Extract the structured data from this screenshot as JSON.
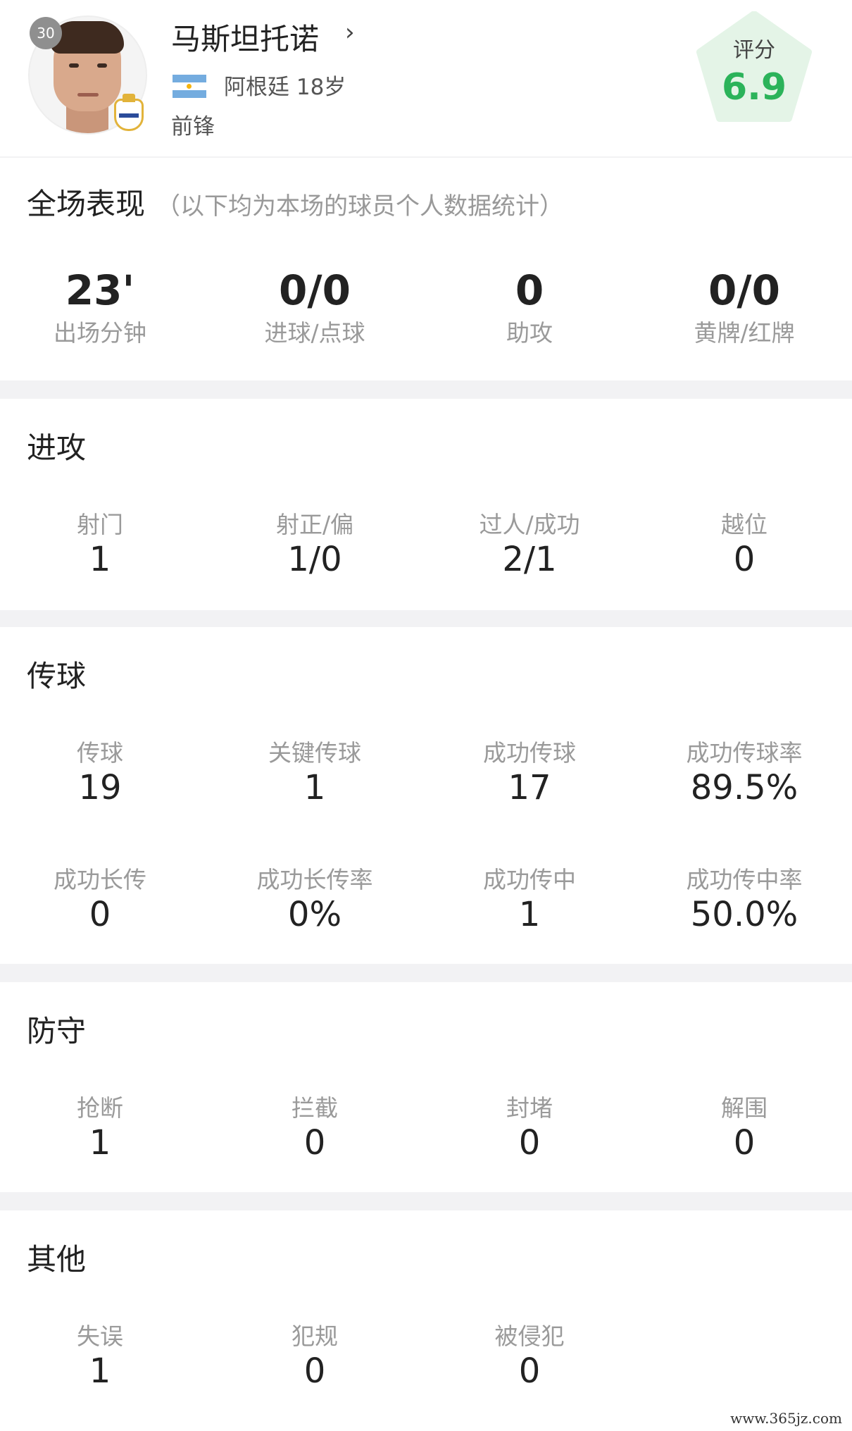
{
  "player": {
    "number": "30",
    "name": "马斯坦托诺",
    "chevron": "›",
    "country_age": "阿根廷  18岁",
    "position": "前锋"
  },
  "rating": {
    "label": "评分",
    "value": "6.9",
    "color": "#2bb35a",
    "badge_color": "#e4f4e7"
  },
  "overall": {
    "title": "全场表现",
    "subtitle": "（以下均为本场的球员个人数据统计）",
    "stats": [
      {
        "value": "23'",
        "label": "出场分钟"
      },
      {
        "value": "0/0",
        "label": "进球/点球"
      },
      {
        "value": "0",
        "label": "助攻"
      },
      {
        "value": "0/0",
        "label": "黄牌/红牌"
      }
    ]
  },
  "attack": {
    "title": "进攻",
    "stats": [
      {
        "label": "射门",
        "value": "1"
      },
      {
        "label": "射正/偏",
        "value": "1/0"
      },
      {
        "label": "过人/成功",
        "value": "2/1"
      },
      {
        "label": "越位",
        "value": "0"
      }
    ]
  },
  "passing": {
    "title": "传球",
    "stats": [
      {
        "label": "传球",
        "value": "19"
      },
      {
        "label": "关键传球",
        "value": "1"
      },
      {
        "label": "成功传球",
        "value": "17"
      },
      {
        "label": "成功传球率",
        "value": "89.5%"
      },
      {
        "label": "成功长传",
        "value": "0"
      },
      {
        "label": "成功长传率",
        "value": "0%"
      },
      {
        "label": "成功传中",
        "value": "1"
      },
      {
        "label": "成功传中率",
        "value": "50.0%"
      }
    ]
  },
  "defense": {
    "title": "防守",
    "stats": [
      {
        "label": "抢断",
        "value": "1"
      },
      {
        "label": "拦截",
        "value": "0"
      },
      {
        "label": "封堵",
        "value": "0"
      },
      {
        "label": "解围",
        "value": "0"
      }
    ]
  },
  "other": {
    "title": "其他",
    "stats": [
      {
        "label": "失误",
        "value": "1"
      },
      {
        "label": "犯规",
        "value": "0"
      },
      {
        "label": "被侵犯",
        "value": "0"
      }
    ]
  },
  "watermark": "www.365jz.com"
}
